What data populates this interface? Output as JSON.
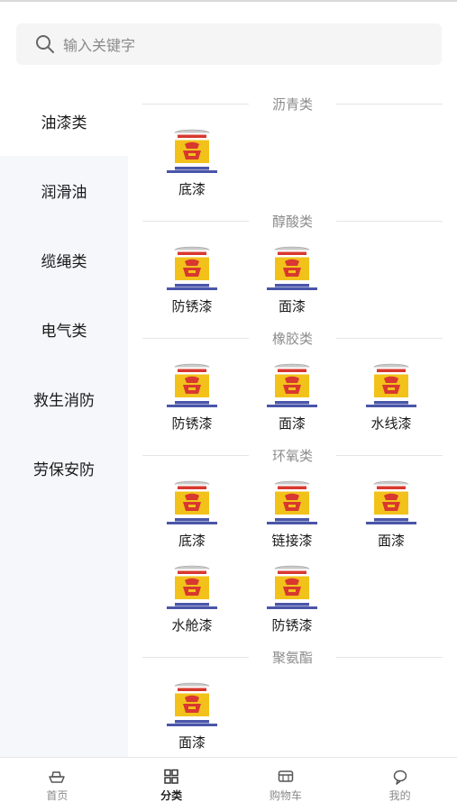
{
  "search": {
    "placeholder": "输入关键字"
  },
  "sidebar": {
    "items": [
      {
        "label": "油漆类",
        "active": true
      },
      {
        "label": "润滑油",
        "active": false
      },
      {
        "label": "缆绳类",
        "active": false
      },
      {
        "label": "电气类",
        "active": false
      },
      {
        "label": "救生消防",
        "active": false
      },
      {
        "label": "劳保安防",
        "active": false
      }
    ]
  },
  "groups": [
    {
      "title": "沥青类",
      "products": [
        "底漆"
      ]
    },
    {
      "title": "醇酸类",
      "products": [
        "防锈漆",
        "面漆"
      ]
    },
    {
      "title": "橡胶类",
      "products": [
        "防锈漆",
        "面漆",
        "水线漆"
      ]
    },
    {
      "title": "环氧类",
      "products": [
        "底漆",
        "链接漆",
        "面漆",
        "水舱漆",
        "防锈漆"
      ]
    },
    {
      "title": "聚氨酯",
      "products": [
        "面漆"
      ]
    }
  ],
  "tabbar": {
    "tabs": [
      {
        "label": "首页",
        "icon": "ship-icon",
        "active": false
      },
      {
        "label": "分类",
        "icon": "grid-icon",
        "active": true
      },
      {
        "label": "购物车",
        "icon": "cart-icon",
        "active": false
      },
      {
        "label": "我的",
        "icon": "chat-bubble-icon",
        "active": false
      }
    ]
  },
  "colors": {
    "sidebar_bg": "#f6f7fb",
    "can_yellow": "#f2c21b",
    "can_blue": "#4a56a8"
  }
}
